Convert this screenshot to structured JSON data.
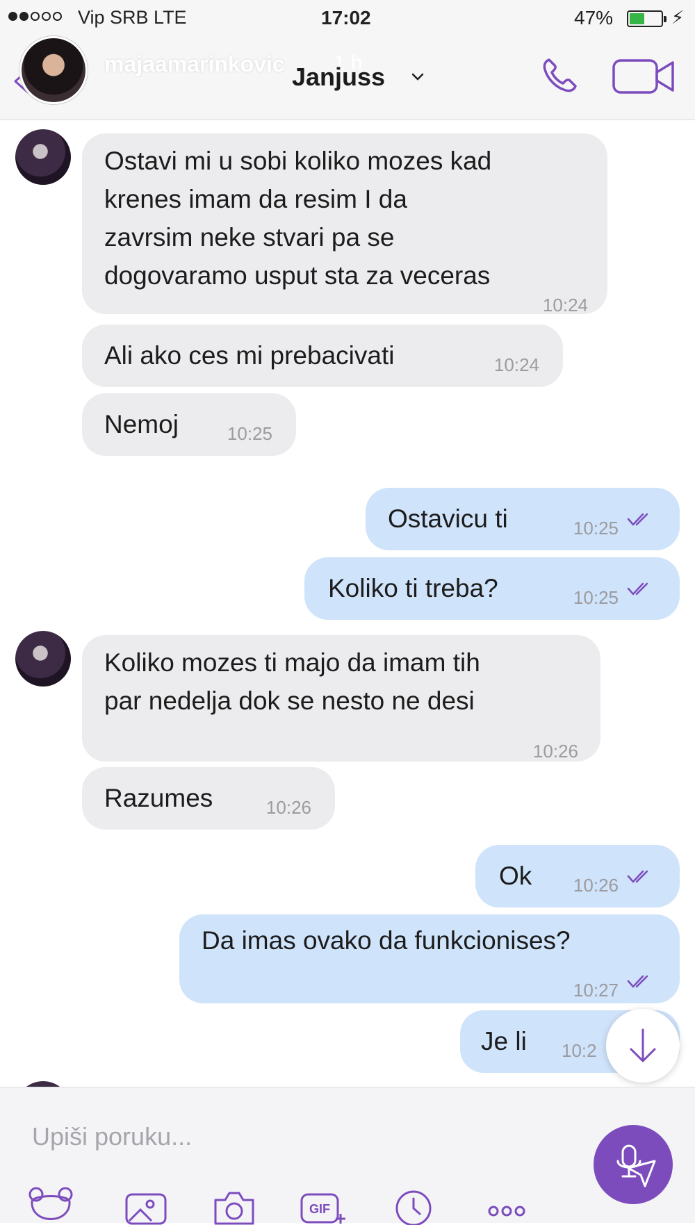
{
  "status_bar": {
    "carrier": "Vip SRB  LTE",
    "time": "17:02",
    "battery_pct": "47%",
    "battery_level": 0.47,
    "battery_color": "#35b546"
  },
  "story_overlay": {
    "username": "majaamarinkovic",
    "age": "1 h"
  },
  "header": {
    "title": "Janjuss",
    "accent_color": "#7c4cbd"
  },
  "messages": [
    {
      "dir": "in",
      "text": "Ostavi mi u sobi koliko mozes kad\nkrenes imam da resim I da\nzavrsim neke stvari pa se\ndogovaramo usput sta za veceras",
      "time": "10:24"
    },
    {
      "dir": "in",
      "text": "Ali ako ces mi prebacivati",
      "time": "10:24"
    },
    {
      "dir": "in",
      "text": "Nemoj",
      "time": "10:25"
    },
    {
      "dir": "out",
      "text": "Ostavicu ti",
      "time": "10:25",
      "read": true
    },
    {
      "dir": "out",
      "text": "Koliko ti treba?",
      "time": "10:25",
      "read": true
    },
    {
      "dir": "in",
      "text": "Koliko mozes ti majo da imam tih\npar nedelja dok se nesto ne desi",
      "time": "10:26"
    },
    {
      "dir": "in",
      "text": "Razumes",
      "time": "10:26"
    },
    {
      "dir": "out",
      "text": "Ok",
      "time": "10:26",
      "read": true
    },
    {
      "dir": "out",
      "text": "Da imas ovako da funkcionises?",
      "time": "10:27",
      "read": true
    },
    {
      "dir": "out",
      "text": "Je li",
      "time": "10:2"
    }
  ],
  "input": {
    "placeholder": "Upiši poruku..."
  },
  "action_bar": {
    "icons": [
      "sticker-icon",
      "gallery-icon",
      "camera-icon",
      "gif-icon",
      "clock-icon",
      "more-icon"
    ],
    "gif_label": "GIF"
  },
  "colors": {
    "incoming_bubble": "#ececee",
    "outgoing_bubble": "#cfe3fb",
    "tick_color": "#7c4cbd"
  }
}
